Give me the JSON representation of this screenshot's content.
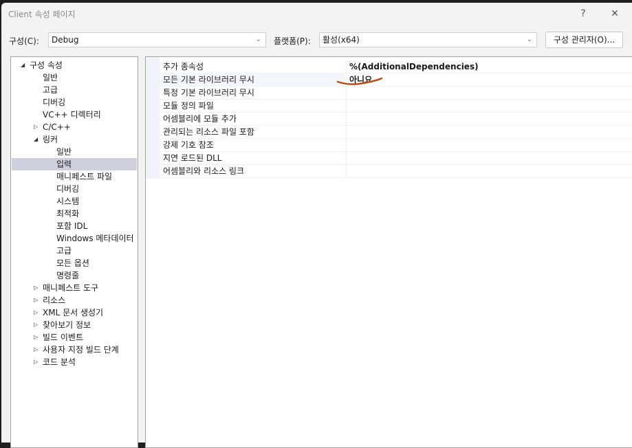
{
  "window": {
    "title": "Client 속성 페이지",
    "help": "?",
    "close": "✕"
  },
  "toolbar": {
    "config_label": "구성(C):",
    "config_value": "Debug",
    "platform_label": "플랫폼(P):",
    "platform_value": "활성(x64)",
    "config_manager": "구성 관리자(O)..."
  },
  "tree": [
    {
      "label": "구성 속성",
      "level": 0,
      "exp": "open"
    },
    {
      "label": "일반",
      "level": 1
    },
    {
      "label": "고급",
      "level": 1
    },
    {
      "label": "디버깅",
      "level": 1
    },
    {
      "label": "VC++ 디렉터리",
      "level": 1
    },
    {
      "label": "C/C++",
      "level": 1,
      "exp": "closed"
    },
    {
      "label": "링커",
      "level": 1,
      "exp": "open"
    },
    {
      "label": "일반",
      "level": 2
    },
    {
      "label": "입력",
      "level": 2,
      "selected": true
    },
    {
      "label": "매니페스트 파일",
      "level": 2
    },
    {
      "label": "디버깅",
      "level": 2
    },
    {
      "label": "시스템",
      "level": 2
    },
    {
      "label": "최적화",
      "level": 2
    },
    {
      "label": "포함 IDL",
      "level": 2
    },
    {
      "label": "Windows 메타데이터",
      "level": 2
    },
    {
      "label": "고급",
      "level": 2
    },
    {
      "label": "모든 옵션",
      "level": 2
    },
    {
      "label": "명령줄",
      "level": 2
    },
    {
      "label": "매니페스트 도구",
      "level": 1,
      "exp": "closed"
    },
    {
      "label": "리소스",
      "level": 1,
      "exp": "closed"
    },
    {
      "label": "XML 문서 생성기",
      "level": 1,
      "exp": "closed"
    },
    {
      "label": "찾아보기 정보",
      "level": 1,
      "exp": "closed"
    },
    {
      "label": "빌드 이벤트",
      "level": 1,
      "exp": "closed"
    },
    {
      "label": "사용자 지정 빌드 단계",
      "level": 1,
      "exp": "closed"
    },
    {
      "label": "코드 분석",
      "level": 1,
      "exp": "closed"
    }
  ],
  "properties": [
    {
      "name": "추가 종속성",
      "value": "%(AdditionalDependencies)"
    },
    {
      "name": "모든 기본 라이브러리 무시",
      "value": "아니요",
      "highlight": true
    },
    {
      "name": "특정 기본 라이브러리 무시",
      "value": ""
    },
    {
      "name": "모듈 정의 파일",
      "value": ""
    },
    {
      "name": "어셈블리에 모듈 추가",
      "value": ""
    },
    {
      "name": "관리되는 리소스 파일 포함",
      "value": ""
    },
    {
      "name": "강제 기호 참조",
      "value": ""
    },
    {
      "name": "지연 로드된 DLL",
      "value": ""
    },
    {
      "name": "어셈블리와 리소스 링크",
      "value": ""
    }
  ],
  "colors": {
    "annotation": "#b5501a",
    "selection": "#cdd0dc"
  }
}
